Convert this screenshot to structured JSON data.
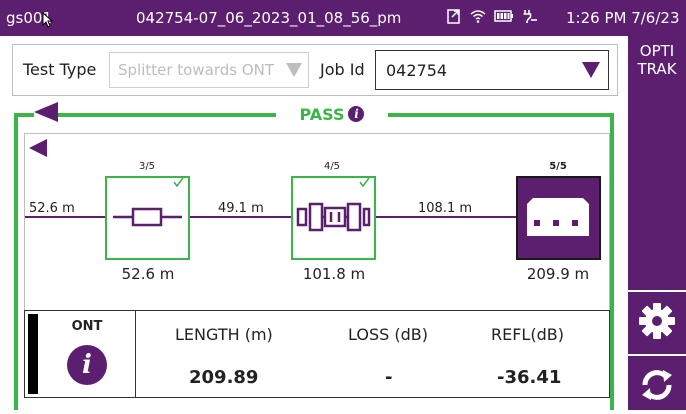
{
  "status_bar": {
    "device": "gs001",
    "filename": "042754-07_06_2023_01_08_56_pm",
    "time": "1:26 PM 7/6/23",
    "icons": [
      "export-icon",
      "wifi-icon",
      "battery-icon",
      "power-plug-icon"
    ]
  },
  "side_panel": {
    "title_line1": "OPTI",
    "title_line2": "TRAK",
    "buttons": [
      "gear-icon",
      "refresh-icon"
    ]
  },
  "form": {
    "test_type_label": "Test Type",
    "test_type_value": "Splitter towards ONT",
    "job_id_label": "Job Id",
    "job_id_value": "042754"
  },
  "result_status": "PASS",
  "diagram": {
    "segments": [
      {
        "length": "52.6 m"
      },
      {
        "length": "49.1 m"
      },
      {
        "length": "108.1 m"
      }
    ],
    "elements": [
      {
        "index": "3/5",
        "type": "connector",
        "distance": "52.6 m",
        "passed": true
      },
      {
        "index": "4/5",
        "type": "splitter",
        "distance": "101.8 m",
        "passed": true
      },
      {
        "index": "5/5",
        "type": "ont",
        "distance": "209.9 m",
        "selected": true
      }
    ]
  },
  "results": {
    "element_name": "ONT",
    "length_header": "LENGTH (m)",
    "loss_header": "LOSS (dB)",
    "refl_header": "REFL(dB)",
    "length_value": "209.89",
    "loss_value": "-",
    "refl_value": "-36.41"
  },
  "colors": {
    "brand_purple": "#5c1e6e",
    "pass_green": "#3bb44a"
  }
}
